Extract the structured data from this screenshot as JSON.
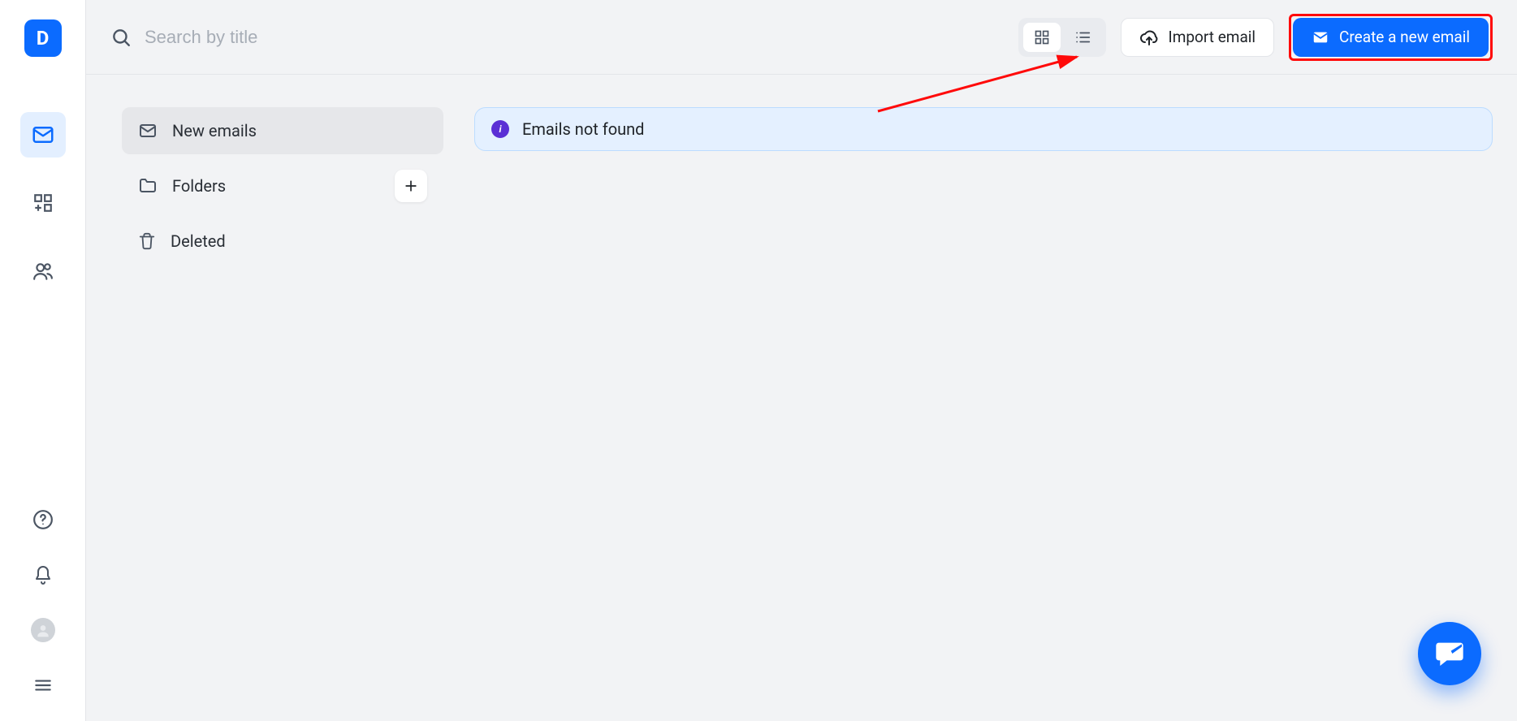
{
  "brand": {
    "initial": "D"
  },
  "search": {
    "placeholder": "Search by title"
  },
  "toolbar": {
    "import_label": "Import email",
    "create_label": "Create a new email",
    "view_mode": "grid"
  },
  "folders": {
    "new_emails": "New emails",
    "folders": "Folders",
    "deleted": "Deleted"
  },
  "content": {
    "empty_alert": "Emails not found"
  },
  "colors": {
    "primary": "#0b6bff",
    "alert_bg": "#e4f0ff",
    "alert_icon": "#5a2fd5",
    "annotation": "#ff0a0a"
  }
}
